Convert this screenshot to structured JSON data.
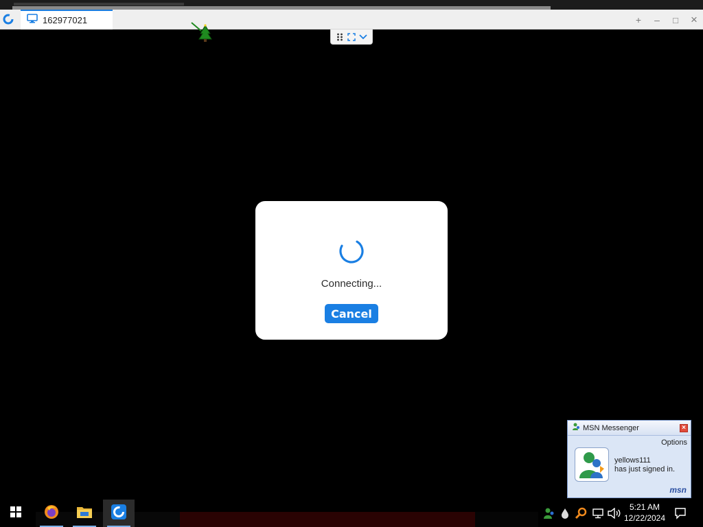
{
  "window": {
    "tab_title": "162977021",
    "controls": {
      "new_tab": "+",
      "minimize": "–",
      "maximize": "□",
      "close": "×"
    }
  },
  "dialog": {
    "status_text": "Connecting...",
    "cancel_label": "Cancel"
  },
  "msn_popup": {
    "title": "MSN Messenger",
    "options_label": "Options",
    "username": "yellows111",
    "message": "has just signed in.",
    "logo_text": "msn"
  },
  "taskbar": {
    "items": [
      "start",
      "firefox",
      "file-explorer",
      "remote-desktop-app"
    ],
    "time": "5:21 AM",
    "date": "12/22/2024"
  },
  "colors": {
    "accent": "#1a7fe3",
    "titlebar": "#efefef",
    "background": "#000000"
  }
}
